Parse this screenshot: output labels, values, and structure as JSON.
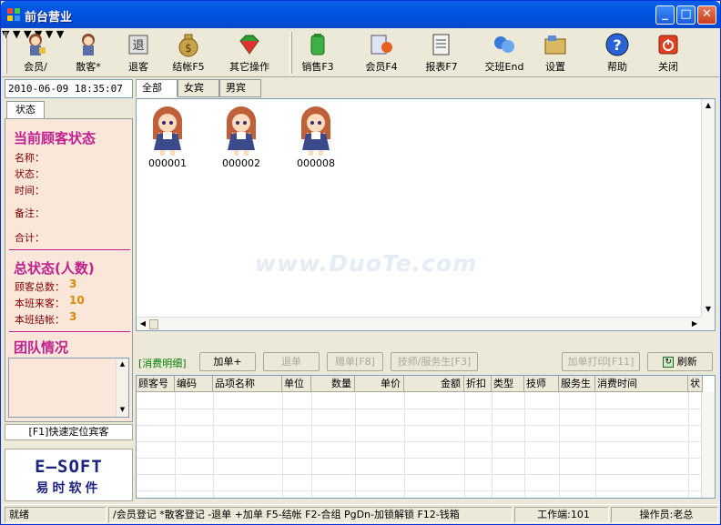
{
  "window": {
    "title": "前台营业"
  },
  "toolbar": {
    "items": [
      {
        "label": "会员/",
        "icon": "member-girl-icon"
      },
      {
        "label": "散客*",
        "icon": "guest-girl-icon"
      },
      {
        "label": "退客",
        "icon": "checkout-guest-icon"
      },
      {
        "label": "结帐F5",
        "icon": "money-bag-icon"
      },
      {
        "label": "其它操作",
        "icon": "gem-icon"
      },
      {
        "label": "销售F3",
        "icon": "green-bottle-icon"
      },
      {
        "label": "会员F4",
        "icon": "member-card-icon"
      },
      {
        "label": "报表F7",
        "icon": "report-icon"
      },
      {
        "label": "交班End",
        "icon": "shift-handover-icon"
      },
      {
        "label": "设置",
        "icon": "settings-icon"
      },
      {
        "label": "帮助",
        "icon": "help-icon"
      },
      {
        "label": "关闭",
        "icon": "power-icon"
      }
    ]
  },
  "left": {
    "datetime": "2010-06-09 18:35:07",
    "tab": "状态",
    "current_title": "当前顾客状态",
    "fields": [
      "名称：",
      "状态：",
      "时间：",
      "备注：",
      "合计："
    ],
    "summary_title": "总状态(人数)",
    "summary": [
      {
        "label": "顾客总数：",
        "value": "3"
      },
      {
        "label": "本班来客：",
        "value": "10"
      },
      {
        "label": "本班结帐：",
        "value": "3"
      }
    ],
    "team_title": "团队情况",
    "locate_label": "[F1]快速定位宾客",
    "logo_line1": "E—SOFT",
    "logo_line2": "易时软件"
  },
  "tabs": [
    "全部",
    "女宾",
    "男宾"
  ],
  "customers": [
    {
      "id": "000001"
    },
    {
      "id": "000002"
    },
    {
      "id": "000008"
    }
  ],
  "buttons": {
    "detail_label": "[消费明细]",
    "add": "加单+",
    "refund": "退单",
    "gift": "赠单[F8]",
    "staff": "技师/服务生[F3]",
    "print": "加单打印[F11]",
    "refresh": "刷新"
  },
  "grid": {
    "columns": [
      "顾客号",
      "编码",
      "品项名称",
      "单位",
      "数量",
      "单价",
      "金额",
      "折扣",
      "类型",
      "技师",
      "服务生",
      "消费时间",
      "状"
    ]
  },
  "statusbar": {
    "state": "就绪",
    "shortcuts": "/会员登记 *散客登记 -退单 +加单 F5-结帐 F2-合组 PgDn-加锁解锁 F12-钱箱",
    "terminal": "工作端:101",
    "operator": "操作员:老总"
  },
  "watermark": "www.DuoTe.com"
}
